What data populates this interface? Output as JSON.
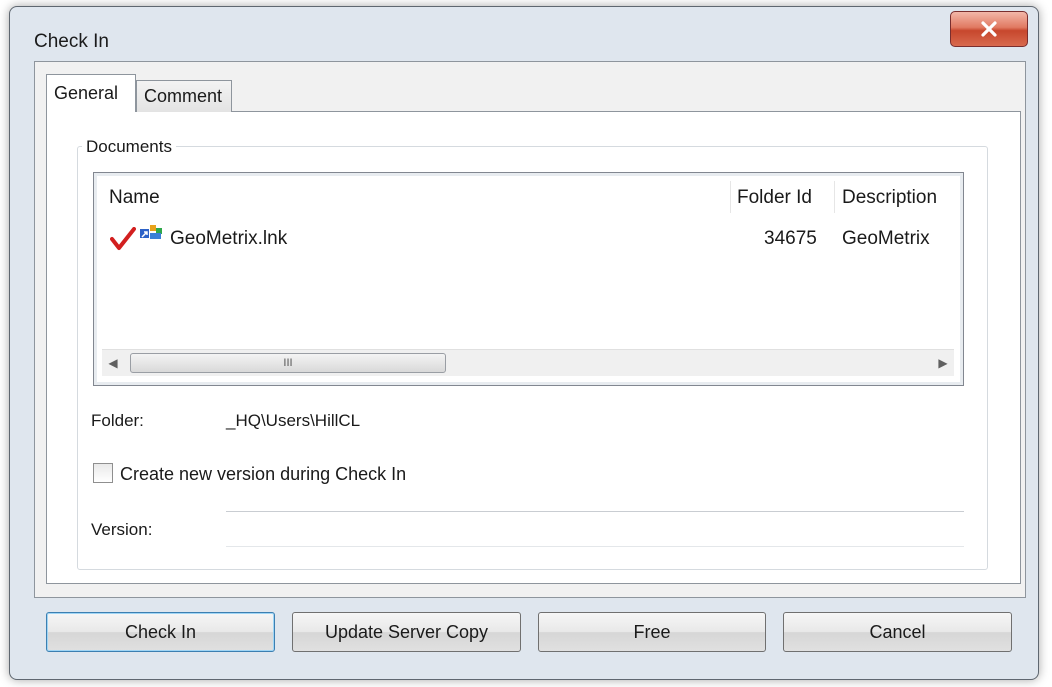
{
  "window": {
    "title": "Check In",
    "close_icon": "close-icon"
  },
  "tabs": [
    {
      "label": "General",
      "active": true
    },
    {
      "label": "Comment",
      "active": false
    }
  ],
  "documents": {
    "group_label": "Documents",
    "columns": [
      "Name",
      "Folder Id",
      "Description"
    ],
    "rows": [
      {
        "name": "GeoMetrix.lnk",
        "folder_id": "34675",
        "description": "GeoMetrix",
        "icons": [
          "check-icon",
          "shortcut-icon"
        ]
      }
    ],
    "scrollbar": {
      "thumb_grip": "III"
    }
  },
  "folder": {
    "label": "Folder:",
    "value": "_HQ\\Users\\HillCL"
  },
  "create_version": {
    "label": "Create new version during Check In",
    "checked": false
  },
  "version": {
    "label": "Version:",
    "value": ""
  },
  "buttons": {
    "check_in": "Check In",
    "update_server_copy": "Update Server Copy",
    "free": "Free",
    "cancel": "Cancel"
  },
  "colors": {
    "check_mark": "#d21f1f",
    "close_button": "#c7472d"
  }
}
